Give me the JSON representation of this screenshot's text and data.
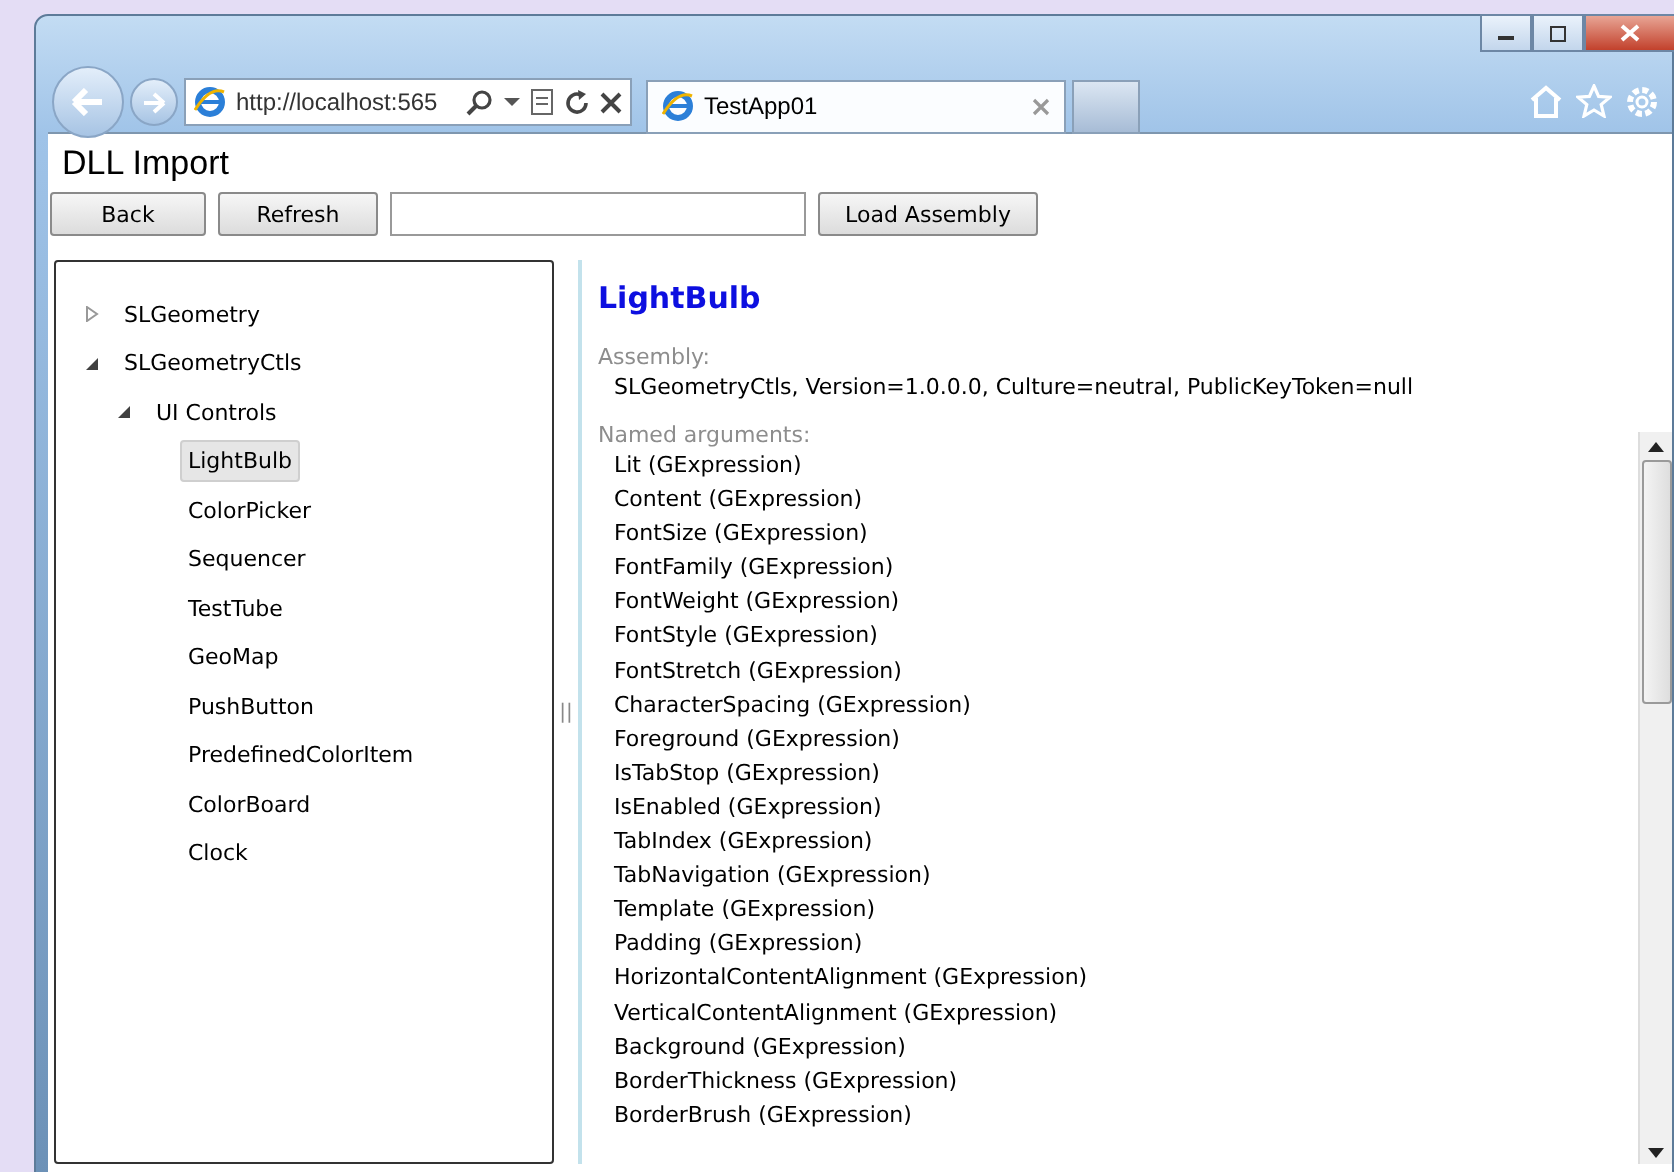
{
  "browser": {
    "address": "http://localhost:565",
    "tab_title": "TestApp01"
  },
  "page": {
    "title": "DLL Import",
    "buttons": [
      {
        "label": "Back"
      },
      {
        "label": "Refresh"
      }
    ],
    "load_button": "Load Assembly"
  },
  "tree": [
    {
      "label": "SLGeometry",
      "expanded": false
    },
    {
      "label": "SLGeometryCtls",
      "expanded": true,
      "children": [
        {
          "label": "UI Controls",
          "expanded": true,
          "children": [
            {
              "label": "LightBulb",
              "selected": true
            },
            {
              "label": "ColorPicker",
              "selected": false
            },
            {
              "label": "Sequencer",
              "selected": false
            },
            {
              "label": "TestTube",
              "selected": false
            },
            {
              "label": "GeoMap",
              "selected": false
            },
            {
              "label": "PushButton",
              "selected": false
            },
            {
              "label": "PredefinedColorItem",
              "selected": false
            },
            {
              "label": "ColorBoard",
              "selected": false
            },
            {
              "label": "Clock",
              "selected": false
            }
          ]
        }
      ]
    }
  ],
  "splitter": "||",
  "details": {
    "title": "LightBulb",
    "assembly_label": "Assembly:",
    "assembly": "SLGeometryCtls, Version=1.0.0.0, Culture=neutral, PublicKeyToken=null",
    "arguments_label": "Named arguments:",
    "arguments": [
      "Lit (GExpression)",
      "Content (GExpression)",
      "FontSize (GExpression)",
      "FontFamily (GExpression)",
      "FontWeight (GExpression)",
      "FontStyle (GExpression)",
      "FontStretch (GExpression)",
      "CharacterSpacing (GExpression)",
      "Foreground (GExpression)",
      "IsTabStop (GExpression)",
      "IsEnabled (GExpression)",
      "TabIndex (GExpression)",
      "TabNavigation (GExpression)",
      "Template (GExpression)",
      "Padding (GExpression)",
      "HorizontalContentAlignment (GExpression)",
      "VerticalContentAlignment (GExpression)",
      "Background (GExpression)",
      "BorderThickness (GExpression)",
      "BorderBrush (GExpression)"
    ]
  }
}
